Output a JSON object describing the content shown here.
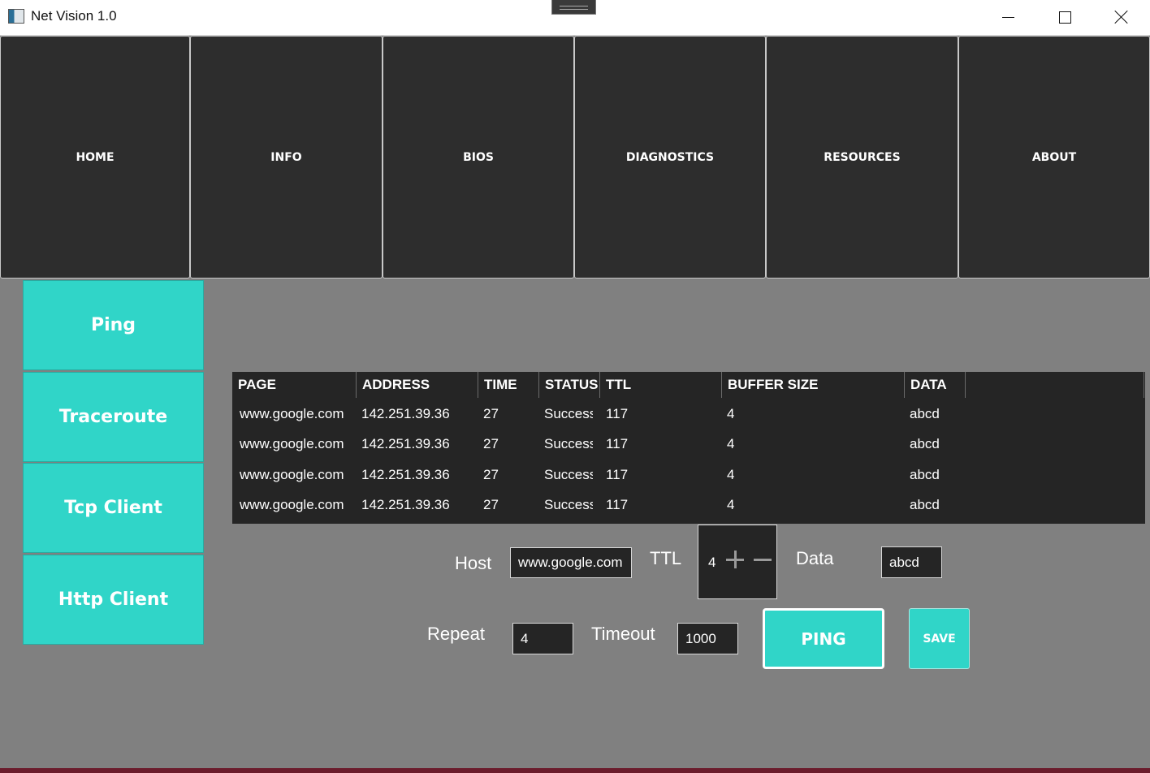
{
  "window": {
    "title": "Net Vision 1.0"
  },
  "top_nav": [
    "HOME",
    "INFO",
    "BIOS",
    "DIAGNOSTICS",
    "RESOURCES",
    "ABOUT"
  ],
  "side_nav": [
    "Ping",
    "Traceroute",
    "Tcp Client",
    "Http Client"
  ],
  "table": {
    "columns": [
      "PAGE",
      "ADDRESS",
      "TIME",
      "STATUS",
      "TTL",
      "BUFFER SIZE",
      "DATA"
    ],
    "rows": [
      [
        "www.google.com",
        "142.251.39.36",
        "27",
        "Success",
        "117",
        "4",
        "abcd"
      ],
      [
        "www.google.com",
        "142.251.39.36",
        "27",
        "Success",
        "117",
        "4",
        "abcd"
      ],
      [
        "www.google.com",
        "142.251.39.36",
        "27",
        "Success",
        "117",
        "4",
        "abcd"
      ],
      [
        "www.google.com",
        "142.251.39.36",
        "27",
        "Success",
        "117",
        "4",
        "abcd"
      ]
    ]
  },
  "form": {
    "host_label": "Host",
    "host_value": "www.google.com",
    "ttl_label": "TTL",
    "ttl_value": "4",
    "data_label": "Data",
    "data_value": "abcd",
    "repeat_label": "Repeat",
    "repeat_value": "4",
    "timeout_label": "Timeout",
    "timeout_value": "1000",
    "ping_button": "PING",
    "save_button": "SAVE"
  },
  "colors": {
    "accent": "#30d5c8",
    "nav_bg": "#2d2d2d",
    "content_bg": "#808080",
    "table_bg": "#252525"
  }
}
